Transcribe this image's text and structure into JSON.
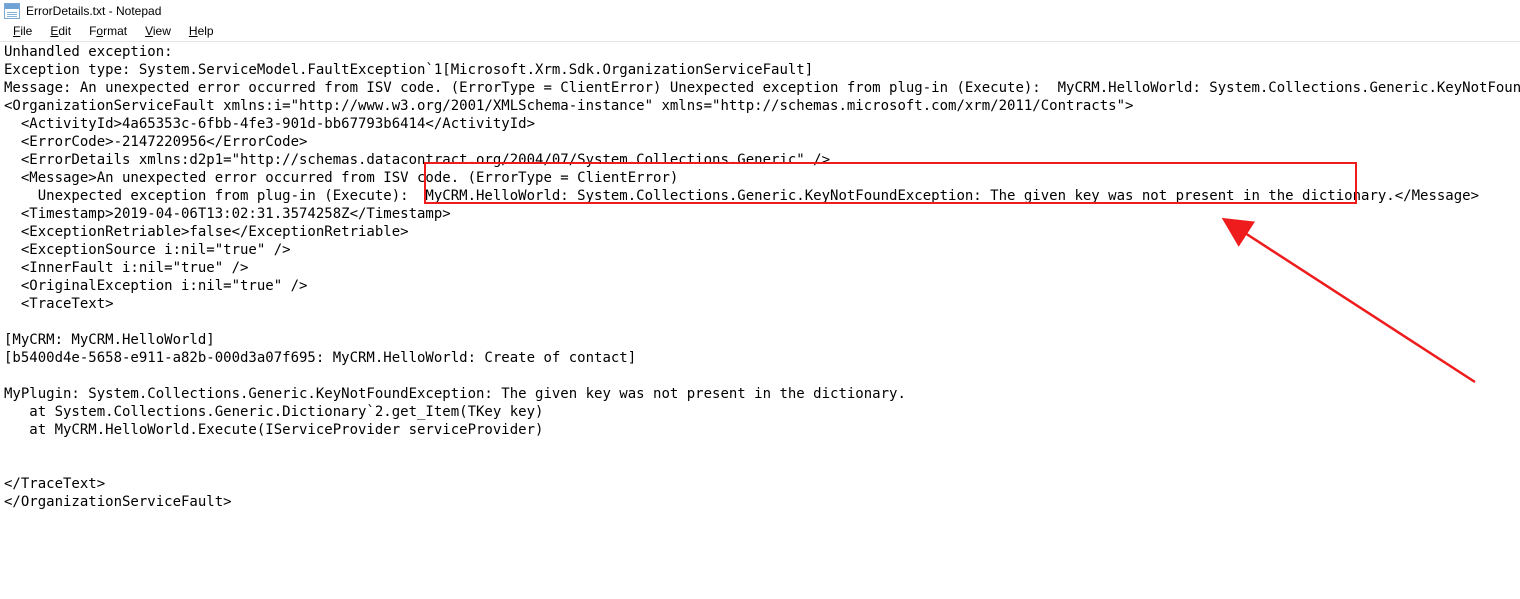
{
  "window": {
    "title": "ErrorDetails.txt - Notepad"
  },
  "menu": {
    "file": "File",
    "edit": "Edit",
    "format": "Format",
    "view": "View",
    "help": "Help"
  },
  "body": {
    "l1": "Unhandled exception: ",
    "l2": "Exception type: System.ServiceModel.FaultException`1[Microsoft.Xrm.Sdk.OrganizationServiceFault]",
    "l3": "Message: An unexpected error occurred from ISV code. (ErrorType = ClientError) Unexpected exception from plug-in (Execute):  MyCRM.HelloWorld: System.Collections.Generic.KeyNotFoundException",
    "l4": "<OrganizationServiceFault xmlns:i=\"http://www.w3.org/2001/XMLSchema-instance\" xmlns=\"http://schemas.microsoft.com/xrm/2011/Contracts\">",
    "l5": "  <ActivityId>4a65353c-6fbb-4fe3-901d-bb67793b6414</ActivityId>",
    "l6": "  <ErrorCode>-2147220956</ErrorCode>",
    "l7": "  <ErrorDetails xmlns:d2p1=\"http://schemas.datacontract.org/2004/07/System.Collections.Generic\" />",
    "l8": "  <Message>An unexpected error occurred from ISV code. (ErrorType = ClientError)",
    "l9": "    Unexpected exception from plug-in (Execute):  MyCRM.HelloWorld: System.Collections.Generic.KeyNotFoundException: The given key was not present in the dictionary.</Message>",
    "l10": "  <Timestamp>2019-04-06T13:02:31.3574258Z</Timestamp>",
    "l11": "  <ExceptionRetriable>false</ExceptionRetriable>",
    "l12": "  <ExceptionSource i:nil=\"true\" />",
    "l13": "  <InnerFault i:nil=\"true\" />",
    "l14": "  <OriginalException i:nil=\"true\" />",
    "l15": "  <TraceText>",
    "l16": "",
    "l17": "[MyCRM: MyCRM.HelloWorld]",
    "l18": "[b5400d4e-5658-e911-a82b-000d3a07f695: MyCRM.HelloWorld: Create of contact]",
    "l19": "",
    "l20": "MyPlugin: System.Collections.Generic.KeyNotFoundException: The given key was not present in the dictionary.",
    "l21": "   at System.Collections.Generic.Dictionary`2.get_Item(TKey key)",
    "l22": "   at MyCRM.HelloWorld.Execute(IServiceProvider serviceProvider)",
    "l23": "",
    "l24": "",
    "l25": "</TraceText>",
    "l26": "</OrganizationServiceFault>"
  }
}
